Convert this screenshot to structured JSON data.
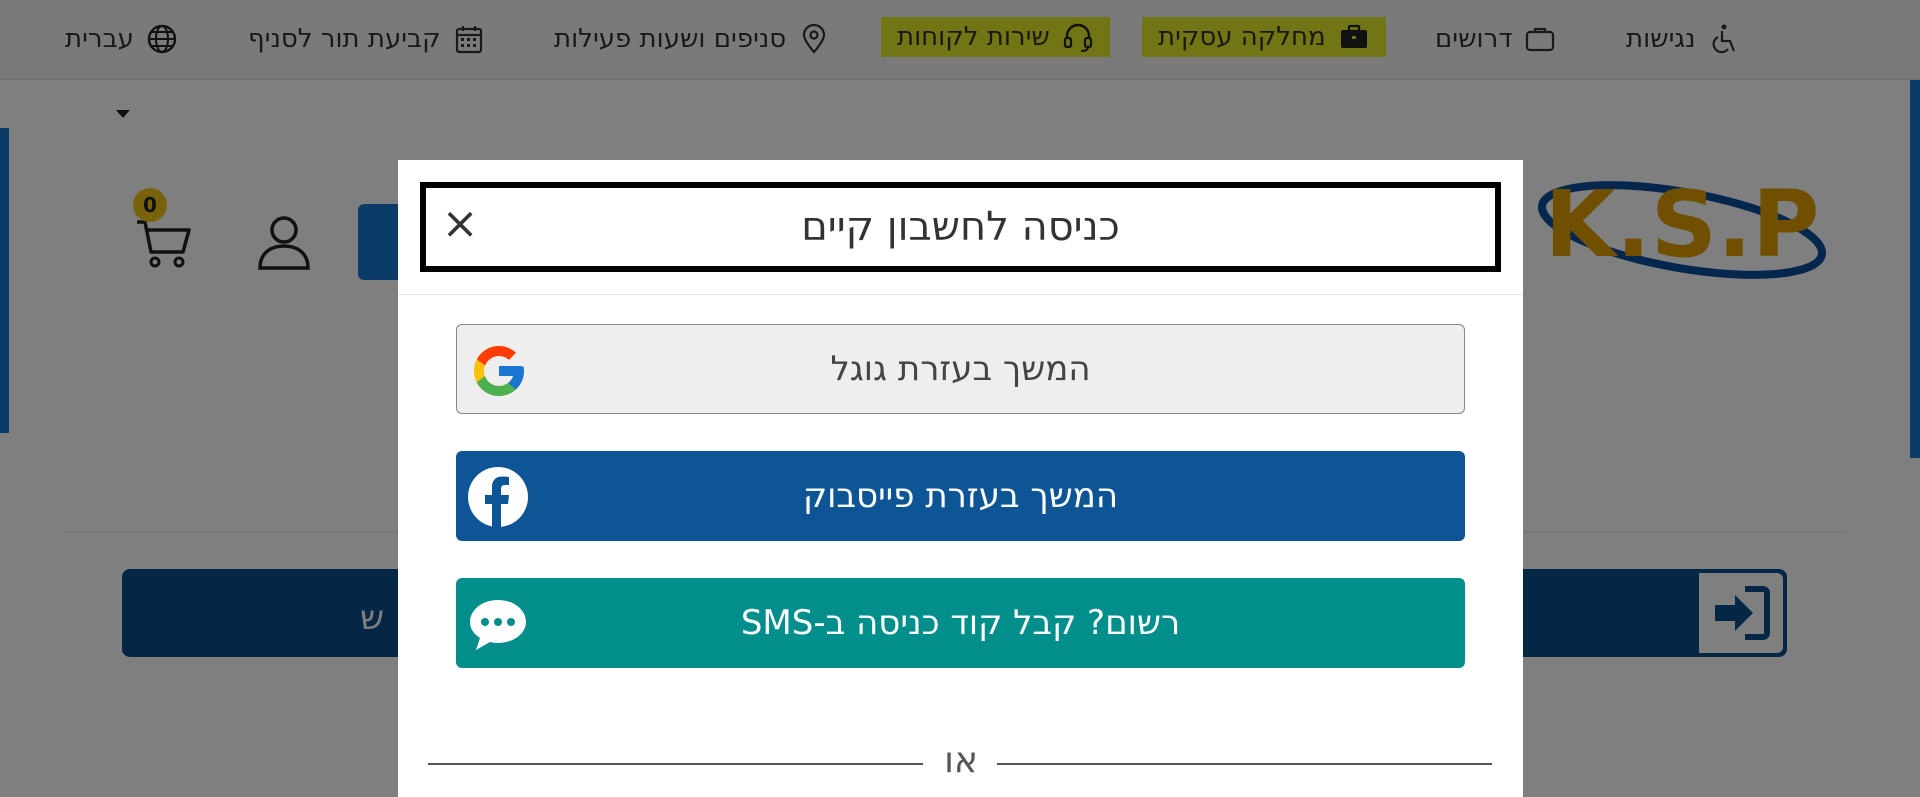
{
  "topbar": {
    "accessibility": "נגישות",
    "jobs": "דרושים",
    "business_dept": "מחלקה עסקית",
    "customer_service": "שירות לקוחות",
    "branches": "סניפים ושעות פעילות",
    "appointment": "קביעת תור לסניף",
    "language": "עברית"
  },
  "header": {
    "cart_count": "0",
    "search_placeholder_fragment": "ש"
  },
  "modal": {
    "title": "כניסה לחשבון קיים",
    "close": "×",
    "google_label": "המשך בעזרת גוגל",
    "facebook_label": "המשך בעזרת פייסבוק",
    "sms_label": "רשום? קבל קוד כניסה ב-SMS",
    "or_label": "או"
  },
  "colors": {
    "highlight": "#e4ea26",
    "facebook": "#0e5596",
    "sms": "#028e8a",
    "brand_blue": "#1779d2"
  }
}
